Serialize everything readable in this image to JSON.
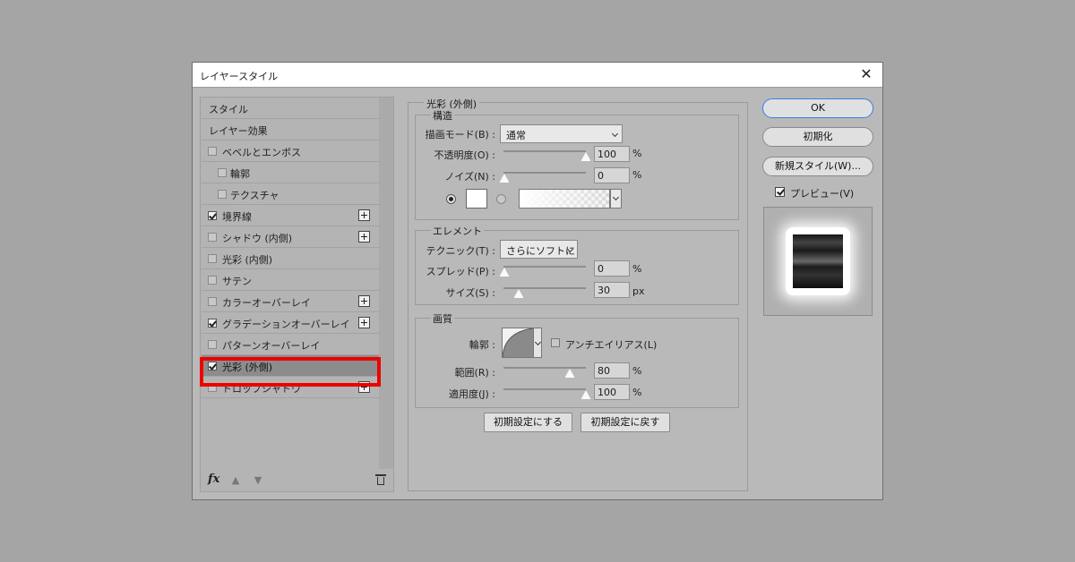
{
  "dialog": {
    "title": "レイヤースタイル"
  },
  "style_list": {
    "items": [
      {
        "label": "スタイル"
      },
      {
        "label": "レイヤー効果"
      },
      {
        "label": "ベベルとエンボス",
        "checked": false
      },
      {
        "label": "輪郭",
        "checked": false
      },
      {
        "label": "テクスチャ",
        "checked": false
      },
      {
        "label": "境界線",
        "checked": true
      },
      {
        "label": "シャドウ (内側)",
        "checked": false
      },
      {
        "label": "光彩 (内側)",
        "checked": false
      },
      {
        "label": "サテン",
        "checked": false
      },
      {
        "label": "カラーオーバーレイ",
        "checked": false
      },
      {
        "label": "グラデーションオーバーレイ",
        "checked": true
      },
      {
        "label": "パターンオーバーレイ",
        "checked": false
      },
      {
        "label": "光彩 (外側)",
        "checked": true,
        "selected": true
      },
      {
        "label": "ドロップシャドウ",
        "checked": false
      }
    ],
    "fx_label": "fx"
  },
  "outer_glow": {
    "title": "光彩 (外側)",
    "structure": {
      "title": "構造",
      "blend_mode_label": "描画モード(B) :",
      "blend_mode_value": "通常",
      "opacity_label": "不透明度(O) :",
      "opacity": 100,
      "noise_label": "ノイズ(N) :",
      "noise": 0,
      "percent": "%"
    },
    "elements": {
      "title": "エレメント",
      "technique_label": "テクニック(T) :",
      "technique_value": "さらにソフトに",
      "spread_label": "スプレッド(P) :",
      "spread": 0,
      "size_label": "サイズ(S) :",
      "size": 30,
      "percent": "%",
      "px": "px"
    },
    "quality": {
      "title": "画質",
      "contour_label": "輪郭 :",
      "antialias_label": "アンチエイリアス(L)",
      "range_label": "範囲(R) :",
      "range": 80,
      "jitter_label": "適用度(J) :",
      "jitter": 100,
      "percent": "%"
    },
    "make_default": "初期設定にする",
    "reset_default": "初期設定に戻す"
  },
  "buttons": {
    "ok": "OK",
    "reset": "初期化",
    "new_style": "新規スタイル(W)...",
    "preview_label": "プレビュー(V)"
  },
  "colors": {
    "highlight": "#ee0000",
    "ok_border": "#3f7ed6"
  }
}
